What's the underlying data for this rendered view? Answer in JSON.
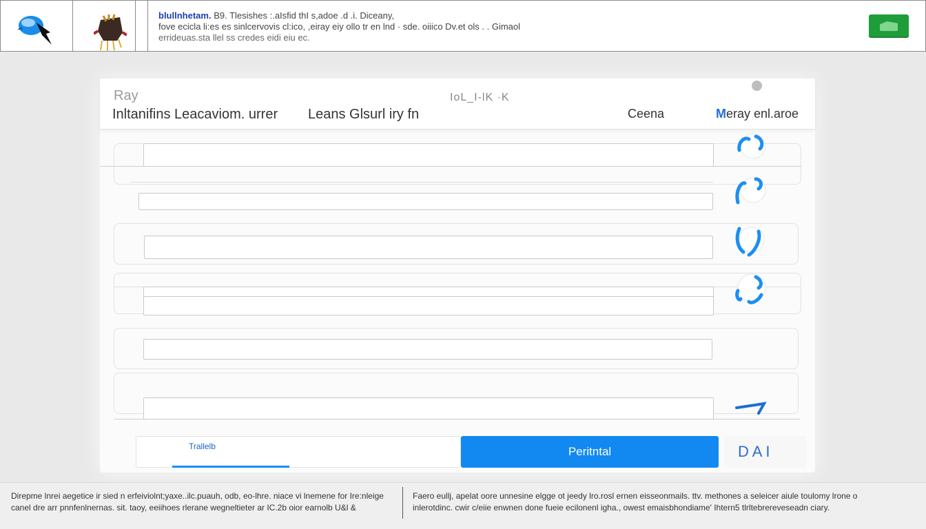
{
  "header": {
    "text_lead": "blullnhetam.",
    "text_line1": "B9. Tlesishes  :.aIsfid thI s,adoe .d  .i. Diceany,",
    "text_line2": "fove ecicla  li:es  es sinlcervovis  cl:ico, ,eiray eiy ollo tr en lnd  · sde.  oiiico Dv.et ols  . . Gimaol",
    "text_line3": "errideuas.sta   llel ss  credes eidi eiu ec.",
    "icons": [
      "bird-icon",
      "bug-icon"
    ],
    "action_color": "#1f9d3a"
  },
  "card": {
    "kicker": "Ray",
    "center_label": "IoL_I-lK  ·K",
    "title": "Inltanifins Leacaviom. urrer",
    "subtitle": "Leans Glsurl iry fn",
    "link_a": "Ceena",
    "link_b_accent": "M",
    "link_b_rest": "eray enl.aroe",
    "fields": [
      "",
      "",
      "",
      "",
      "",
      "",
      ""
    ],
    "toggle_count": 5,
    "accent_color": "#1289f0"
  },
  "actions": {
    "tab_label": "Trallelb",
    "primary_label": "Peritntal",
    "secondary_label": "D A I"
  },
  "footer": {
    "left_line1": "Direpme lnrei  aegetice ir sied n erfeiviolnt;yaxe..ilc.puauh,  odb,  eo-lhre. niace vi  lnemene for Ire:nleige",
    "left_line2": "canel dre arr pnnfenlnernas.  sit.  taoy,  eeiihoes  rlerane   wegneltieter ar IC.2b  oior  earnolb  U&l &",
    "right_line1": "Faero eullj,  apelat oore   unnesine  elgge  ot jeedy  lro.rosl ernen eisseonmails.  ttv.  methones  a seleicer  aiule  toulomy   lrone o",
    "right_line2": "inlerotdinc.  cwir  c/eiie  enwnen done  fueie  ecilonenl igha.,  owest  emaisbhondiame' Ihtern5  tlrltebrereveseadn  ciary."
  }
}
